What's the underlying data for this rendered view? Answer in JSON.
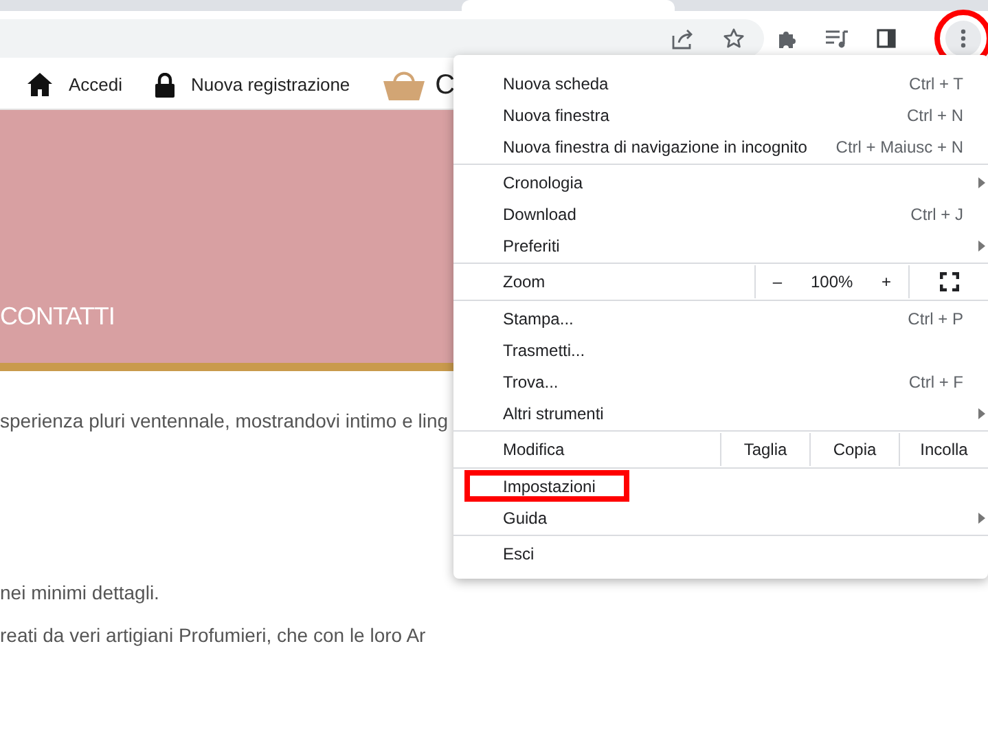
{
  "toolbar": {
    "menu_button": {
      "highlighted": true
    }
  },
  "site_nav": {
    "items": [
      {
        "kind": "home",
        "label": "Accedi"
      },
      {
        "kind": "lock",
        "label": "Nuova registrazione"
      },
      {
        "kind": "basket",
        "label": "C"
      }
    ]
  },
  "hero": {
    "title": "CONTATTI"
  },
  "body": {
    "paragraphs": [
      "sperienza pluri ventennale, mostrandovi intimo e ling",
      "nei minimi dettagli.",
      "reati da veri artigiani Profumieri, che con le loro Ar"
    ]
  },
  "menu": {
    "sections": [
      {
        "items": [
          {
            "kind": "item",
            "label": "Nuova scheda",
            "shortcut": "Ctrl + T",
            "submenu": false,
            "highlighted": false
          },
          {
            "kind": "item",
            "label": "Nuova finestra",
            "shortcut": "Ctrl + N",
            "submenu": false,
            "highlighted": false
          },
          {
            "kind": "item",
            "label": "Nuova finestra di navigazione in incognito",
            "shortcut": "Ctrl + Maiusc + N",
            "submenu": false,
            "highlighted": false
          }
        ]
      },
      {
        "items": [
          {
            "kind": "item",
            "label": "Cronologia",
            "submenu": true,
            "highlighted": false
          },
          {
            "kind": "item",
            "label": "Download",
            "shortcut": "Ctrl + J",
            "submenu": false,
            "highlighted": false
          },
          {
            "kind": "item",
            "label": "Preferiti",
            "submenu": true,
            "highlighted": false
          }
        ]
      },
      {
        "items": [
          {
            "kind": "zoom",
            "label": "Zoom",
            "minus": "–",
            "value": "100%",
            "plus": "+"
          }
        ]
      },
      {
        "items": [
          {
            "kind": "item",
            "label": "Stampa...",
            "shortcut": "Ctrl + P",
            "submenu": false,
            "highlighted": false
          },
          {
            "kind": "item",
            "label": "Trasmetti...",
            "submenu": false,
            "highlighted": false
          },
          {
            "kind": "item",
            "label": "Trova...",
            "shortcut": "Ctrl + F",
            "submenu": false,
            "highlighted": false
          },
          {
            "kind": "item",
            "label": "Altri strumenti",
            "submenu": true,
            "highlighted": false
          }
        ]
      },
      {
        "items": [
          {
            "kind": "edit",
            "label": "Modifica",
            "buttons": [
              "Taglia",
              "Copia",
              "Incolla"
            ]
          }
        ]
      },
      {
        "items": [
          {
            "kind": "item",
            "label": "Impostazioni",
            "submenu": false,
            "highlighted": true
          },
          {
            "kind": "item",
            "label": "Guida",
            "submenu": true,
            "highlighted": false
          }
        ]
      },
      {
        "items": [
          {
            "kind": "item",
            "label": "Esci",
            "submenu": false,
            "highlighted": false
          }
        ]
      }
    ]
  }
}
